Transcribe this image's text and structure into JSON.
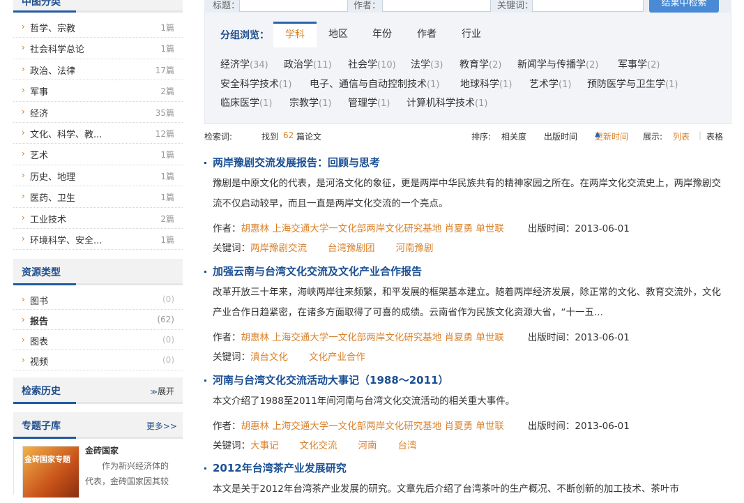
{
  "sidebar": {
    "categories_title": "中图分类",
    "categories": [
      {
        "label": "哲学、宗教",
        "count": "1篇"
      },
      {
        "label": "社会科学总论",
        "count": "1篇"
      },
      {
        "label": "政治、法律",
        "count": "17篇"
      },
      {
        "label": "军事",
        "count": "2篇"
      },
      {
        "label": "经济",
        "count": "35篇"
      },
      {
        "label": "文化、科学、教...",
        "count": "12篇"
      },
      {
        "label": "艺术",
        "count": "1篇"
      },
      {
        "label": "历史、地理",
        "count": "1篇"
      },
      {
        "label": "医药、卫生",
        "count": "1篇"
      },
      {
        "label": "工业技术",
        "count": "2篇"
      },
      {
        "label": "环境科学、安全...",
        "count": "1篇"
      }
    ],
    "resource_title": "资源类型",
    "resources": [
      {
        "label": "图书",
        "count": "(0)"
      },
      {
        "label": "报告",
        "count": "(62)"
      },
      {
        "label": "图表",
        "count": "(0)"
      },
      {
        "label": "视频",
        "count": "(0)"
      }
    ],
    "history_title": "检索历史",
    "history_toggle": "展开",
    "subdb_title": "专题子库",
    "subdb_more": "更多>>",
    "subdb_item_title": "金砖国家",
    "subdb_item_cover": "金砖国家专题",
    "subdb_item_desc": "作为新兴经济体的代表，金砖国家因其较"
  },
  "search": {
    "title_label": "标题：",
    "author_label": "作者：",
    "keyword_label": "关键词：",
    "button": "结果中检索"
  },
  "group": {
    "label": "分组浏览：",
    "tabs": [
      "学科",
      "地区",
      "年份",
      "作者",
      "行业"
    ],
    "subjects": [
      {
        "name": "经济学",
        "count": "(34)"
      },
      {
        "name": "政治学",
        "count": "(11)"
      },
      {
        "name": "社会学",
        "count": "(10)"
      },
      {
        "name": "法学",
        "count": "(3)"
      },
      {
        "name": "教育学",
        "count": "(2)"
      },
      {
        "name": "新闻学与传播学",
        "count": "(2)"
      },
      {
        "name": "军事学",
        "count": "(2)"
      },
      {
        "name": "安全科学技术",
        "count": "(1)"
      },
      {
        "name": "电子、通信与自动控制技术",
        "count": "(1)"
      },
      {
        "name": "地球科学",
        "count": "(1)"
      },
      {
        "name": "艺术学",
        "count": "(1)"
      },
      {
        "name": "预防医学与卫生学",
        "count": "(1)"
      },
      {
        "name": "临床医学",
        "count": "(1)"
      },
      {
        "name": "宗教学",
        "count": "(1)"
      },
      {
        "name": "管理学",
        "count": "(1)"
      },
      {
        "name": "计算机科学技术",
        "count": "(1)"
      }
    ]
  },
  "meta": {
    "query_label": "检索词:",
    "found_prefix": "找到",
    "found_count": "62",
    "found_suffix": "篇论文",
    "sort_label": "排序:",
    "sort_relevance": "相关度",
    "sort_pubtime": "出版时间",
    "sort_updated": "更新时间",
    "display_label": "展示:",
    "view_list": "列表",
    "view_table": "表格"
  },
  "results": [
    {
      "title": "两岸豫剧交流发展报告：回顾与思考",
      "abstract": "豫剧是中原文化的代表，是河洛文化的象征，更是两岸中华民族共有的精神家园之所在。在两岸文化交流史上，两岸豫剧交流不仅启动较早，而且一直是两岸文化交流的一个亮点。",
      "author_label": "作者：",
      "authors": [
        "胡惠林",
        "上海交通大学一文化部两岸文化研究基地",
        "肖夏勇",
        "单世联"
      ],
      "date_label": "出版时间：",
      "date": "2013-06-01",
      "kw_label": "关键词：",
      "keywords": [
        "两岸豫剧交流",
        "台湾豫剧团",
        "河南豫剧"
      ]
    },
    {
      "title": "加强云南与台湾文化交流及文化产业合作报告",
      "abstract": "改革开放三十年来，海峡两岸往来频繁，和平发展的框架基本建立。随着两岸经济发展，除正常的文化、教育交流外，文化产业合作日趋紧密，在诸多方面取得了可喜的成绩。云南省作为民族文化资源大省，“十一五...",
      "author_label": "作者：",
      "authors": [
        "胡惠林",
        "上海交通大学一文化部两岸文化研究基地",
        "肖夏勇",
        "单世联"
      ],
      "date_label": "出版时间：",
      "date": "2013-06-01",
      "kw_label": "关键词：",
      "keywords": [
        "滇台文化",
        "文化产业合作"
      ]
    },
    {
      "title": "河南与台湾文化交流活动大事记（1988～2011）",
      "abstract": "本文介绍了1988至2011年间河南与台湾文化交流活动的相关重大事件。",
      "author_label": "作者：",
      "authors": [
        "胡惠林",
        "上海交通大学一文化部两岸文化研究基地",
        "肖夏勇",
        "单世联"
      ],
      "date_label": "出版时间：",
      "date": "2013-06-01",
      "kw_label": "关键词：",
      "keywords": [
        "大事记",
        "文化交流",
        "河南",
        "台湾"
      ]
    },
    {
      "title": "2012年台湾茶产业发展研究",
      "abstract": "本文是关于2012年台湾茶产业发展的研究。文章先后介绍了台湾茶叶的生产概况、不断创新的加工技术、茶叶市"
    }
  ]
}
